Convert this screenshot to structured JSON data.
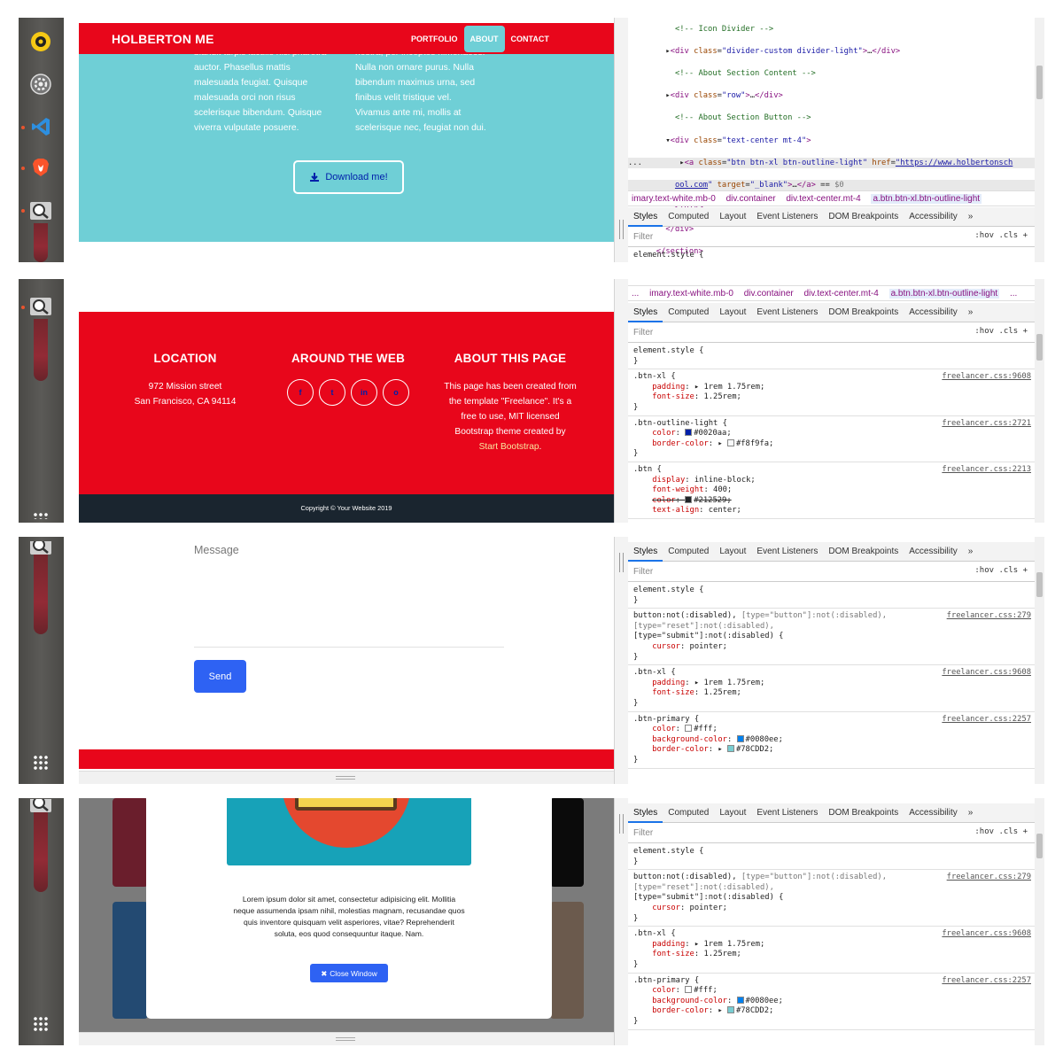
{
  "colors": {
    "primary_red": "#e8061b",
    "teal": "#6fcfd6",
    "dark_footer": "#1a252f",
    "primary_blue": "#2e62f3",
    "link_blue": "#0020aa"
  },
  "navbar": {
    "brand": "HOLBERTON ME",
    "links": [
      "PORTFOLIO",
      "ABOUT",
      "CONTACT"
    ]
  },
  "about": {
    "col1": [
      "blandit turpis iaculis nisi pharetra",
      "auctor. Phasellus mattis",
      "malesuada feugiat. Quisque",
      "malesuada orci non risus",
      "scelerisque bibendum. Quisque",
      "viverra vulputate posuere."
    ],
    "col2": [
      "nostra, per inceptos himenaeos.",
      "Nulla non ornare purus. Nulla",
      "bibendum maximus urna, sed",
      "finibus velit tristique vel.",
      "Vivamus ante mi, mollis at",
      "scelerisque nec, feugiat non dui."
    ],
    "download_button": "Download me!"
  },
  "footer": {
    "location_title": "LOCATION",
    "location_lines": [
      "972 Mission street",
      "San Francisco, CA 94114"
    ],
    "web_title": "AROUND THE WEB",
    "social": [
      "f",
      "t",
      "in",
      "o"
    ],
    "about_title": "ABOUT THIS PAGE",
    "about_lines": [
      "This page has been created from",
      "the template \"Freelance\". It's a",
      "free to use, MIT licensed",
      "Bootstrap theme created by"
    ],
    "about_link": "Start Bootstrap",
    "copyright": "Copyright © Your Website 2019"
  },
  "contact": {
    "message_label": "Message",
    "send_button": "Send"
  },
  "modal": {
    "text_lines": [
      "Lorem ipsum dolor sit amet, consectetur adipisicing elit. Mollitia",
      "neque assumenda ipsam nihil, molestias magnam, recusandae quos",
      "quis inventore quisquam velit asperiores, vitae? Reprehenderit",
      "soluta, eos quod consequuntur itaque. Nam."
    ],
    "close_button": "Close Window"
  },
  "devtools": {
    "breadcrumbs": [
      "...",
      "imary.text-white.mb-0",
      "div.container",
      "div.text-center.mt-4",
      "a.btn.btn-xl.btn-outline-light",
      "..."
    ],
    "tabs": [
      "Styles",
      "Computed",
      "Layout",
      "Event Listeners",
      "DOM Breakpoints",
      "Accessibility",
      "»"
    ],
    "filter_placeholder": "Filter",
    "filter_tools": ":hov  .cls  +",
    "element_style": "element.style {",
    "sources": {
      "btn_xl": "freelancer.css:9608",
      "btn_outline_light": "freelancer.css:2721",
      "btn": "freelancer.css:2213",
      "button_not_disabled": "freelancer.css:279",
      "btn_primary": "freelancer.css:2257"
    }
  }
}
